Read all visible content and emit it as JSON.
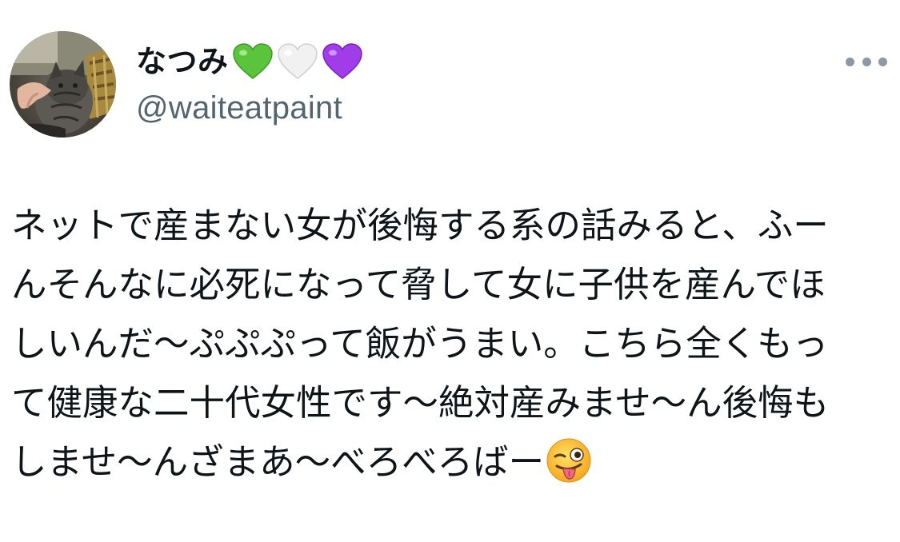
{
  "author": {
    "display_name": "なつみ",
    "handle": "@waiteatpaint",
    "avatar_icon": "avatar-cat-photo",
    "name_emojis": [
      "green-heart-icon",
      "white-heart-icon",
      "purple-heart-icon"
    ]
  },
  "header": {
    "more_icon": "more-options-icon"
  },
  "tweet": {
    "lines": [
      "ネットで産まない女が後悔する系の話みると、ふー",
      "んそんなに必死になって脅して女に子供を産んでほ",
      "しいんだ〜ぷぷぷって飯がうまい。こちら全くもっ",
      "て健康な二十代女性です〜絶対産みませ〜ん後悔も",
      "しませ〜んざまあ〜べろべろばー"
    ],
    "trailing_emoji": "winking-face-with-tongue-icon"
  },
  "colors": {
    "text": "#0f1419",
    "secondary": "#536471",
    "green_heart": "#5ac43c",
    "purple_heart": "#a03ce8",
    "white_heart": "#eeeeee"
  }
}
